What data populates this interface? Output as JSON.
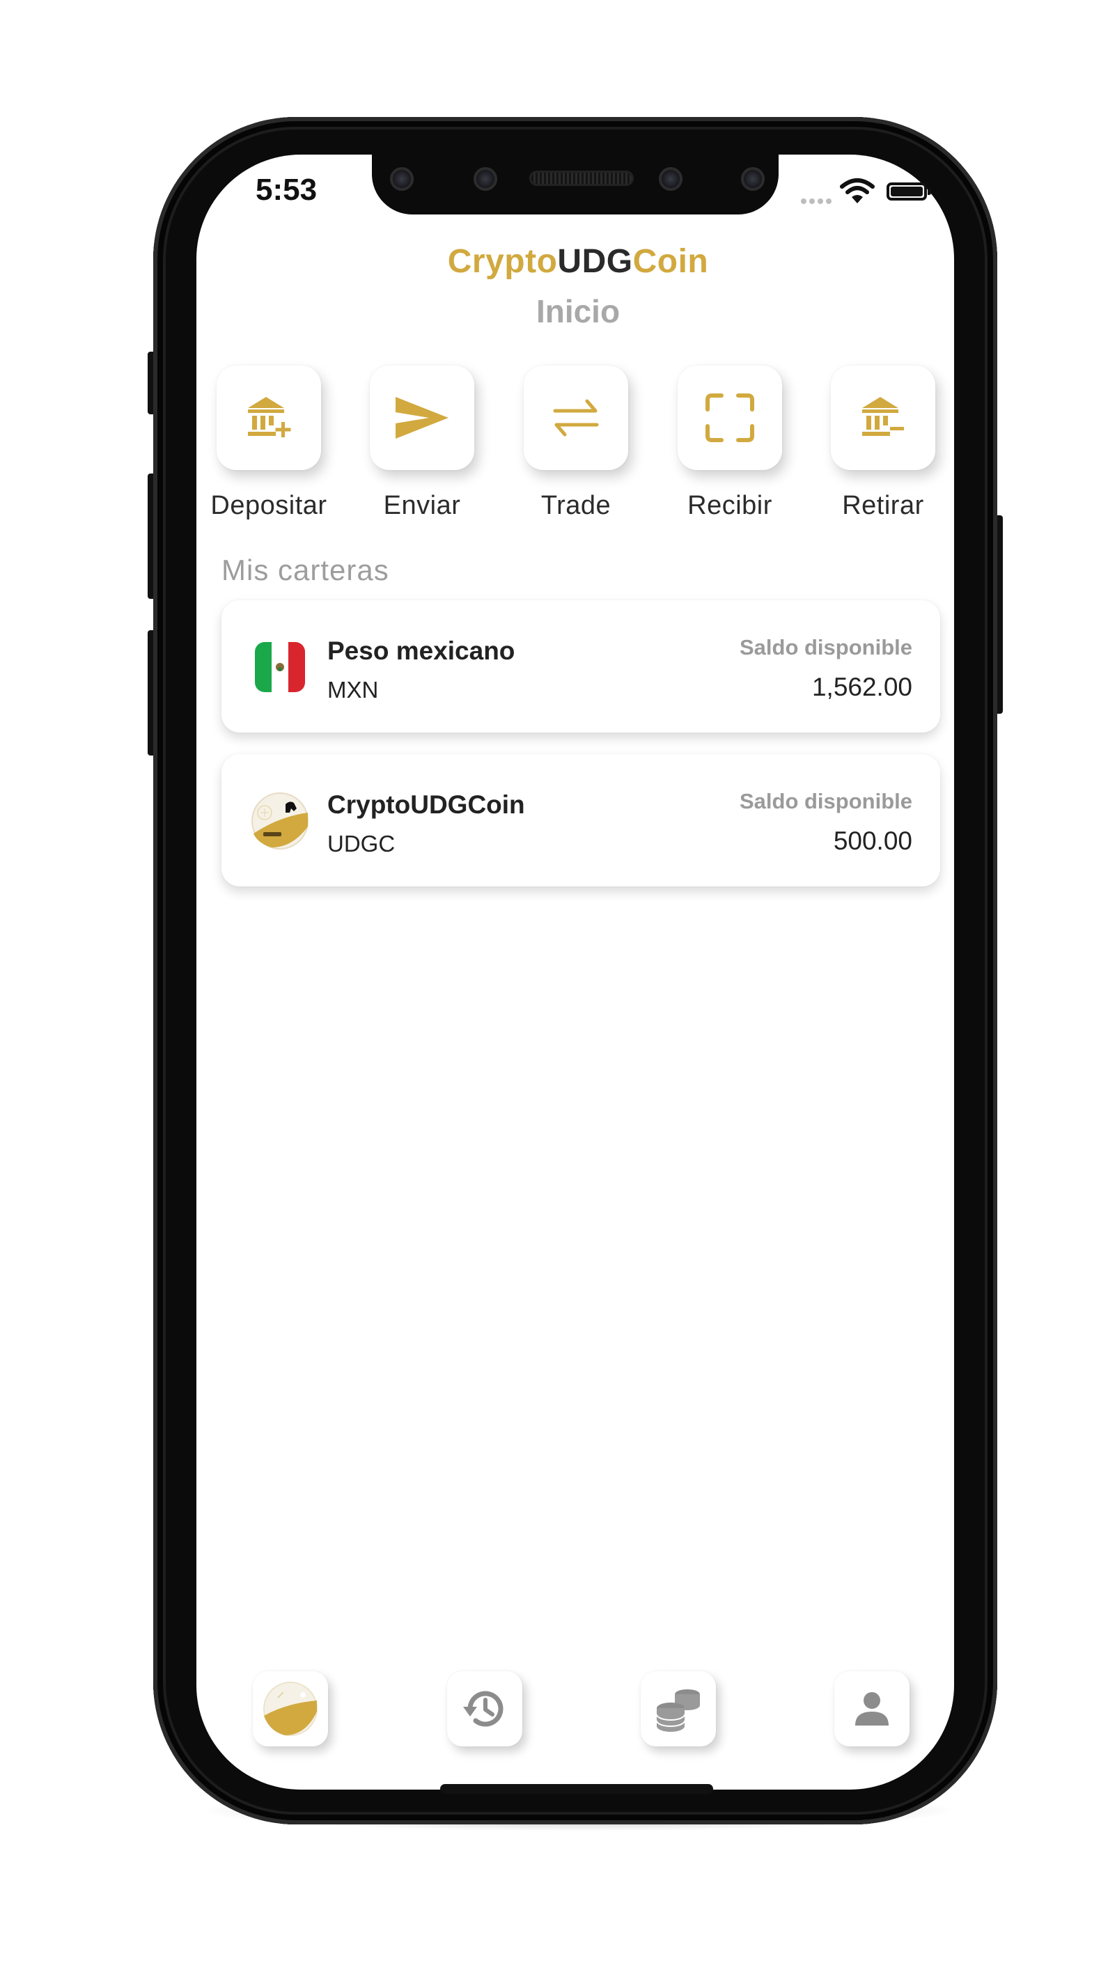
{
  "status_bar": {
    "time": "5:53"
  },
  "header": {
    "brand_part1": "Crypto",
    "brand_part2": "UDG",
    "brand_part3": "Coin",
    "title": "Inicio"
  },
  "actions": [
    {
      "label": "Depositar",
      "icon": "bank-plus-icon"
    },
    {
      "label": "Enviar",
      "icon": "send-icon"
    },
    {
      "label": "Trade",
      "icon": "swap-arrows-icon"
    },
    {
      "label": "Recibir",
      "icon": "scan-frame-icon"
    },
    {
      "label": "Retirar",
      "icon": "bank-minus-icon"
    }
  ],
  "wallets_section": {
    "title": "Mis carteras"
  },
  "wallets": [
    {
      "name": "Peso mexicano",
      "code": "MXN",
      "balance_label": "Saldo disponible",
      "balance": "1,562.00",
      "icon": "mexico-flag-icon"
    },
    {
      "name": "CryptoUDGCoin",
      "code": "UDGC",
      "balance_label": "Saldo disponible",
      "balance": "500.00",
      "icon": "udgc-coin-icon"
    }
  ],
  "bottom_nav": [
    {
      "icon": "udgc-home-icon",
      "active": true
    },
    {
      "icon": "history-icon",
      "active": false
    },
    {
      "icon": "coins-stack-icon",
      "active": false
    },
    {
      "icon": "user-icon",
      "active": false
    }
  ],
  "colors": {
    "accent": "#d1a93f",
    "muted": "#a8a8a8",
    "text": "#222222",
    "mexico_green": "#1aa84a",
    "mexico_red": "#d9262e"
  }
}
